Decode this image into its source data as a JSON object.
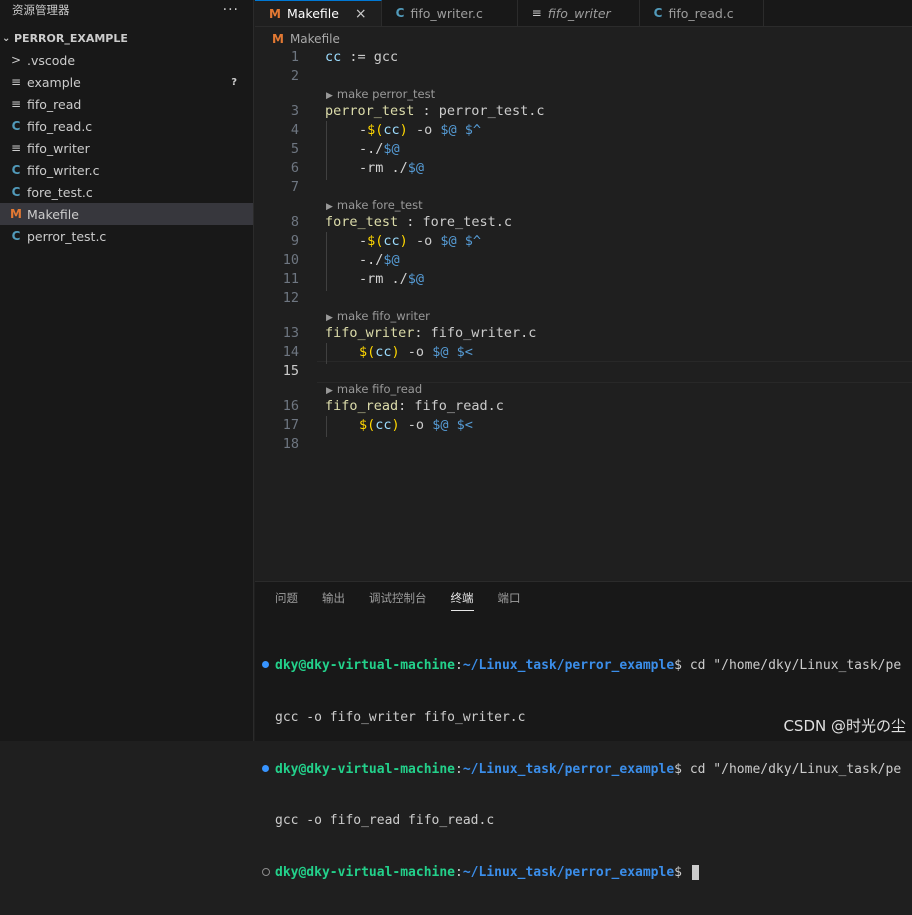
{
  "sidebar": {
    "title": "资源管理器",
    "more": "···",
    "folder": "PERROR_EXAMPLE",
    "files": [
      {
        "icon": ">",
        "label": ".vscode",
        "badge": ""
      },
      {
        "icon": "≡",
        "label": "example",
        "badge": "?"
      },
      {
        "icon": "≡",
        "label": "fifo_read",
        "badge": ""
      },
      {
        "icon": "C",
        "label": "fifo_read.c",
        "badge": ""
      },
      {
        "icon": "≡",
        "label": "fifo_writer",
        "badge": ""
      },
      {
        "icon": "C",
        "label": "fifo_writer.c",
        "badge": ""
      },
      {
        "icon": "C",
        "label": "fore_test.c",
        "badge": ""
      },
      {
        "icon": "M",
        "label": "Makefile",
        "badge": ""
      },
      {
        "icon": "C",
        "label": "perror_test.c",
        "badge": ""
      }
    ]
  },
  "tabs": [
    {
      "icon": "M",
      "label": "Makefile",
      "close": "×"
    },
    {
      "icon": "C",
      "label": "fifo_writer.c"
    },
    {
      "icon": "≡",
      "label": "fifo_writer"
    },
    {
      "icon": "C",
      "label": "fifo_read.c"
    }
  ],
  "breadcrumb": {
    "icon": "M",
    "label": "Makefile"
  },
  "editor": {
    "line_numbers": [
      "1",
      "2",
      "3",
      "4",
      "5",
      "6",
      "7",
      "8",
      "9",
      "10",
      "11",
      "12",
      "13",
      "14",
      "15",
      "16",
      "17",
      "18"
    ],
    "codelens": [
      "make perror_test",
      "make fore_test",
      "make fifo_writer",
      "make fifo_read"
    ],
    "lines": {
      "l1": [
        "cc",
        " := ",
        "gcc"
      ],
      "l3": [
        "perror_test",
        " : ",
        "perror_test.c"
      ],
      "l4": [
        "-",
        "$(",
        "cc",
        ")",
        " -o ",
        "$@",
        " ",
        "$^"
      ],
      "l5": [
        "-./",
        "$@"
      ],
      "l6": [
        "-rm ./",
        "$@"
      ],
      "l8": [
        "fore_test",
        " : ",
        "fore_test.c"
      ],
      "l9": [
        "-",
        "$(",
        "cc",
        ")",
        " -o ",
        "$@",
        " ",
        "$^"
      ],
      "l10": [
        "-./",
        "$@"
      ],
      "l11": [
        "-rm ./",
        "$@"
      ],
      "l13": [
        "fifo_writer",
        ": ",
        "fifo_writer.c"
      ],
      "l14": [
        "$(",
        "cc",
        ")",
        " -o ",
        "$@",
        " ",
        "$<"
      ],
      "l16": [
        "fifo_read",
        ": ",
        "fifo_read.c"
      ],
      "l17": [
        "$(",
        "cc",
        ")",
        " -o ",
        "$@",
        " ",
        "$<"
      ]
    }
  },
  "panel": {
    "tabs": [
      "问题",
      "输出",
      "调试控制台",
      "终端",
      "端口"
    ],
    "active_tab": "终端",
    "terminal": [
      {
        "user": "dky@dky-virtual-machine",
        "sep": ":",
        "path": "~/Linux_task/perror_example",
        "cmd": "$ cd \"/home/dky/Linux_task/pe"
      },
      {
        "text": "gcc -o fifo_writer fifo_writer.c"
      },
      {
        "user": "dky@dky-virtual-machine",
        "sep": ":",
        "path": "~/Linux_task/perror_example",
        "cmd": "$ cd \"/home/dky/Linux_task/pe"
      },
      {
        "text": "gcc -o fifo_read fifo_read.c"
      },
      {
        "user": "dky@dky-virtual-machine",
        "sep": ":",
        "path": "~/Linux_task/perror_example",
        "cmd": "$ "
      }
    ]
  },
  "watermark": "CSDN @时光の尘",
  "colors": {
    "accent": "#0078d4",
    "makefile_icon": "#e37933",
    "c_icon": "#519aba"
  }
}
